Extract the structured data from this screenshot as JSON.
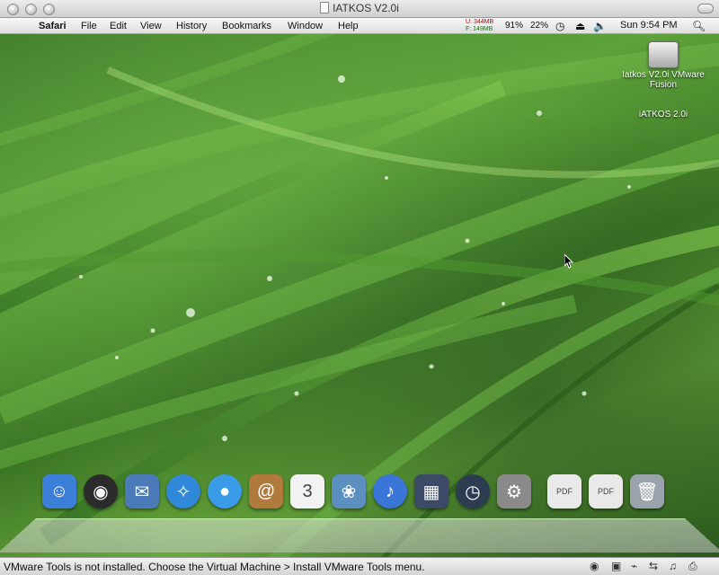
{
  "window": {
    "title": "IATKOS V2.0i"
  },
  "menubar": {
    "app_name": "Safari",
    "items": [
      "File",
      "Edit",
      "View",
      "History",
      "Bookmarks",
      "Window",
      "Help"
    ],
    "memory_used": "U: 344MB",
    "memory_free": "F: 149MB",
    "cpu_percent": "91%",
    "battery_percent": "22%",
    "clock": "Sun 9:54 PM"
  },
  "desktop": {
    "icons": [
      {
        "label": "Iatkos V2.0i VMware Fusion",
        "icon": "hard-drive-icon"
      },
      {
        "label": "iATKOS 2.0i",
        "icon": "apple-disk-icon"
      }
    ]
  },
  "dock": {
    "items": [
      {
        "name": "finder",
        "glyph": "☺",
        "color": "#3b7fd9"
      },
      {
        "name": "dashboard",
        "glyph": "◉",
        "color": "#2b2b2b"
      },
      {
        "name": "mail",
        "glyph": "✉",
        "color": "#4a7ab8"
      },
      {
        "name": "safari",
        "glyph": "✧",
        "color": "#2f88d8"
      },
      {
        "name": "ichat",
        "glyph": "●",
        "color": "#3a9be8"
      },
      {
        "name": "address-book",
        "glyph": "@",
        "color": "#b07a3c"
      },
      {
        "name": "ical",
        "glyph": "3",
        "color": "#f2f2f2"
      },
      {
        "name": "iphoto",
        "glyph": "❀",
        "color": "#5a8fc0"
      },
      {
        "name": "itunes",
        "glyph": "♪",
        "color": "#3a75d8"
      },
      {
        "name": "spaces",
        "glyph": "▦",
        "color": "#3c4a66"
      },
      {
        "name": "time-machine",
        "glyph": "◷",
        "color": "#2c3d52"
      },
      {
        "name": "system-preferences",
        "glyph": "⚙",
        "color": "#8a8a8a"
      },
      {
        "name": "pdf-document-1",
        "glyph": "PDF",
        "color": "#e9e9e9"
      },
      {
        "name": "pdf-document-2",
        "glyph": "PDF",
        "color": "#e9e9e9"
      },
      {
        "name": "trash",
        "glyph": "🗑",
        "color": "#9aa3ab"
      }
    ]
  },
  "vmware": {
    "status_message": "VMware Tools is not installed. Choose the Virtual Machine > Install VMware Tools menu."
  }
}
